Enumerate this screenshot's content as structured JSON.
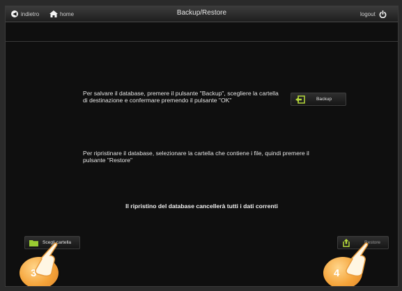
{
  "topbar": {
    "back_label": "indietro",
    "home_label": "home",
    "title": "Backup/Restore",
    "logout_label": "logout"
  },
  "backup_section": {
    "instruction": "Per salvare il database, premere il pulsante \"Backup\", scegliere la cartella di destinazione e confermare premendo il pulsante \"OK\"",
    "button_label": "Backup"
  },
  "restore_section": {
    "instruction": "Per ripristinare il database, selezionare la cartella che contiene i file, quindi premere il pulsante \"Restore\""
  },
  "warning": "Il ripristino del database cancellerà tutti i dati correnti",
  "bottom_controls": {
    "choose_folder_label": "Scegli cartella",
    "restore_label": "Restore"
  },
  "callouts": {
    "left_number": "3",
    "right_number": "4"
  },
  "colors": {
    "background": "#0f0f0f",
    "backup_icon": "#b6d93a",
    "folder_icon": "#9acd32",
    "callout": "#f5a43a"
  },
  "icons": {
    "back": "back-arrow-icon",
    "home": "home-icon",
    "logout": "power-icon",
    "backup": "backup-icon",
    "folder": "folder-icon",
    "restore": "restore-icon"
  }
}
